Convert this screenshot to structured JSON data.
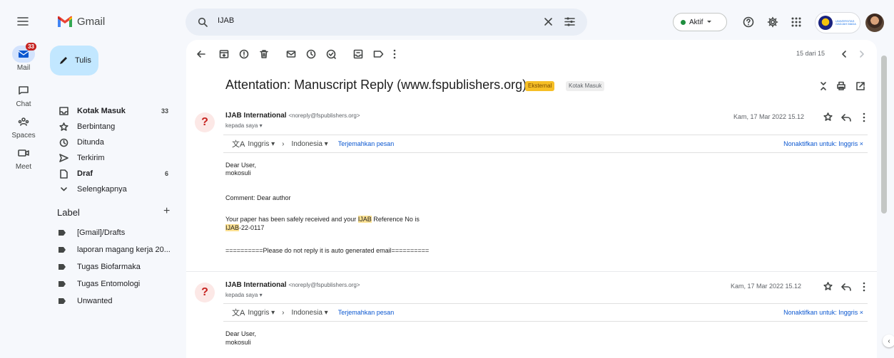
{
  "app": {
    "name": "Gmail"
  },
  "rail": {
    "mail": {
      "label": "Mail",
      "badge": "33"
    },
    "chat": {
      "label": "Chat"
    },
    "spaces": {
      "label": "Spaces"
    },
    "meet": {
      "label": "Meet"
    }
  },
  "sidebar": {
    "compose": "Tulis",
    "items": [
      {
        "label": "Kotak Masuk",
        "count": "33",
        "icon": "inbox-icon"
      },
      {
        "label": "Berbintang",
        "count": "",
        "icon": "star-icon"
      },
      {
        "label": "Ditunda",
        "count": "",
        "icon": "clock-icon"
      },
      {
        "label": "Terkirim",
        "count": "",
        "icon": "send-icon"
      },
      {
        "label": "Draf",
        "count": "6",
        "icon": "draft-icon"
      },
      {
        "label": "Selengkapnya",
        "count": "",
        "icon": "chevron-down-icon"
      }
    ],
    "label_title": "Label",
    "labels": [
      "[Gmail]/Drafts",
      "laporan magang kerja 20...",
      "Tugas Biofarmaka",
      "Tugas Entomologi",
      "Unwanted"
    ]
  },
  "search": {
    "value": "IJAB"
  },
  "status": {
    "label": "Aktif",
    "color": "#1e8e3e"
  },
  "org": {
    "name": "UNIVERSITAS GADJAH MADA"
  },
  "thread": {
    "pager": "15 dari 15",
    "subject": "Attentation: Manuscript Reply (www.fspublishers.org)",
    "chips": {
      "external": "Eksternal",
      "inbox": "Kotak Masuk"
    },
    "messages": [
      {
        "sender": "IJAB International",
        "email": "<noreply@fspublishers.org>",
        "to": "kepada saya",
        "date": "Kam, 17 Mar 2022 15.12",
        "translate": {
          "from": "Inggris",
          "to": "Indonesia",
          "action": "Terjemahkan pesan",
          "disable": "Nonaktifkan untuk: Inggris"
        },
        "body": {
          "l1": "Dear User,",
          "l2": "mokosuli",
          "l3": "Comment: Dear author",
          "l4a": "Your paper has been safely received and your ",
          "l4b": "IJAB",
          "l4c": " Reference No is",
          "l5a": "IJAB",
          "l5b": "-22-0117",
          "l6": "==========Please do not reply it is auto generated email=========="
        }
      },
      {
        "sender": "IJAB International",
        "email": "<noreply@fspublishers.org>",
        "to": "kepada saya",
        "date": "Kam, 17 Mar 2022 15.12",
        "translate": {
          "from": "Inggris",
          "to": "Indonesia",
          "action": "Terjemahkan pesan",
          "disable": "Nonaktifkan untuk: Inggris"
        },
        "body": {
          "l1": "Dear User,",
          "l2": "mokosuli"
        }
      }
    ]
  }
}
